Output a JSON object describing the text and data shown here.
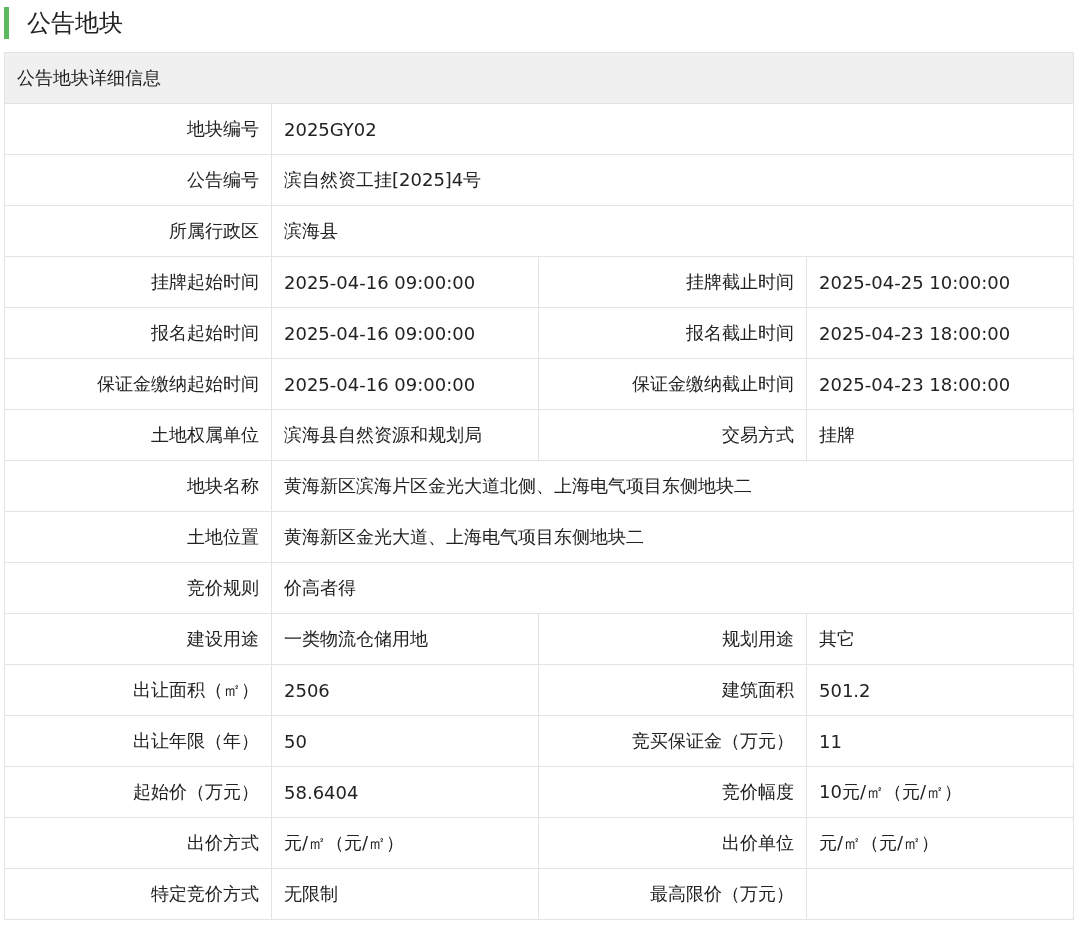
{
  "page_title": "公告地块",
  "panel": {
    "title": "公告地块详细信息",
    "rows": [
      {
        "fields": [
          {
            "label": "地块编号",
            "value": "2025GY02"
          }
        ]
      },
      {
        "fields": [
          {
            "label": "公告编号",
            "value": "滨自然资工挂[2025]4号"
          }
        ]
      },
      {
        "fields": [
          {
            "label": "所属行政区",
            "value": "滨海县"
          }
        ]
      },
      {
        "fields": [
          {
            "label": "挂牌起始时间",
            "value": "2025-04-16 09:00:00"
          },
          {
            "label": "挂牌截止时间",
            "value": "2025-04-25 10:00:00"
          }
        ]
      },
      {
        "fields": [
          {
            "label": "报名起始时间",
            "value": "2025-04-16 09:00:00"
          },
          {
            "label": "报名截止时间",
            "value": "2025-04-23 18:00:00"
          }
        ]
      },
      {
        "fields": [
          {
            "label": "保证金缴纳起始时间",
            "value": "2025-04-16 09:00:00"
          },
          {
            "label": "保证金缴纳截止时间",
            "value": "2025-04-23 18:00:00"
          }
        ]
      },
      {
        "fields": [
          {
            "label": "土地权属单位",
            "value": "滨海县自然资源和规划局"
          },
          {
            "label": "交易方式",
            "value": "挂牌"
          }
        ]
      },
      {
        "fields": [
          {
            "label": "地块名称",
            "value": "黄海新区滨海片区金光大道北侧、上海电气项目东侧地块二"
          }
        ]
      },
      {
        "fields": [
          {
            "label": "土地位置",
            "value": "黄海新区金光大道、上海电气项目东侧地块二"
          }
        ]
      },
      {
        "fields": [
          {
            "label": "竞价规则",
            "value": "价高者得"
          }
        ]
      },
      {
        "fields": [
          {
            "label": "建设用途",
            "value": "一类物流仓储用地"
          },
          {
            "label": "规划用途",
            "value": "其它"
          }
        ]
      },
      {
        "fields": [
          {
            "label": "出让面积（㎡）",
            "value": "2506"
          },
          {
            "label": "建筑面积",
            "value": "501.2"
          }
        ]
      },
      {
        "fields": [
          {
            "label": "出让年限（年）",
            "value": "50"
          },
          {
            "label": "竞买保证金（万元）",
            "value": "11"
          }
        ]
      },
      {
        "fields": [
          {
            "label": "起始价（万元）",
            "value": "58.6404"
          },
          {
            "label": "竞价幅度",
            "value": "10元/㎡（元/㎡）"
          }
        ]
      },
      {
        "fields": [
          {
            "label": "出价方式",
            "value": "元/㎡（元/㎡）"
          },
          {
            "label": "出价单位",
            "value": "元/㎡（元/㎡）"
          }
        ]
      },
      {
        "fields": [
          {
            "label": "特定竞价方式",
            "value": "无限制"
          },
          {
            "label": "最高限价（万元）"
          }
        ]
      }
    ]
  }
}
